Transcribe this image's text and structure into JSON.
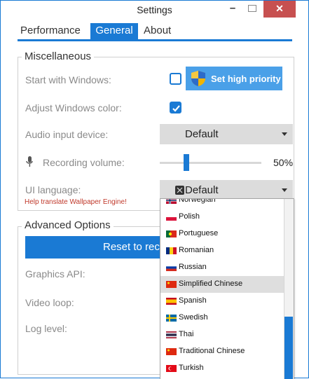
{
  "window": {
    "title": "Settings",
    "minimize_glyph": "–",
    "close_glyph": "✕"
  },
  "tabs": [
    {
      "label": "Performance",
      "active": false
    },
    {
      "label": "General",
      "active": true
    },
    {
      "label": "About",
      "active": false
    }
  ],
  "misc": {
    "title": "Miscellaneous",
    "start_with_windows": {
      "label": "Start with Windows:",
      "checked": false
    },
    "priority_button": {
      "label": "Set high priority",
      "icon": "uac-shield-icon"
    },
    "adjust_color": {
      "label": "Adjust Windows color:",
      "checked": true
    },
    "audio_input": {
      "label": "Audio input device:",
      "value": "Default"
    },
    "recording_volume": {
      "label": "Recording volume:",
      "value": 0.5,
      "value_text": "50%",
      "icon": "microphone-icon"
    },
    "ui_language": {
      "label": "UI language:",
      "value": "Default",
      "help_link": "Help translate Wallpaper Engine!"
    }
  },
  "advanced": {
    "title": "Advanced Options",
    "reset_button": "Reset to rec",
    "graphics_api": "Graphics API:",
    "video_loop": "Video loop:",
    "log_level": "Log level:"
  },
  "language_dropdown": {
    "partial_top": "Norwegian",
    "items": [
      "Polish",
      "Portuguese",
      "Romanian",
      "Russian",
      "Simplified Chinese",
      "Spanish",
      "Swedish",
      "Thai",
      "Traditional Chinese",
      "Turkish"
    ],
    "selected": "Simplified Chinese"
  },
  "colors": {
    "accent": "#1a7ad4",
    "close": "#c75050",
    "link": "#c0392b"
  }
}
